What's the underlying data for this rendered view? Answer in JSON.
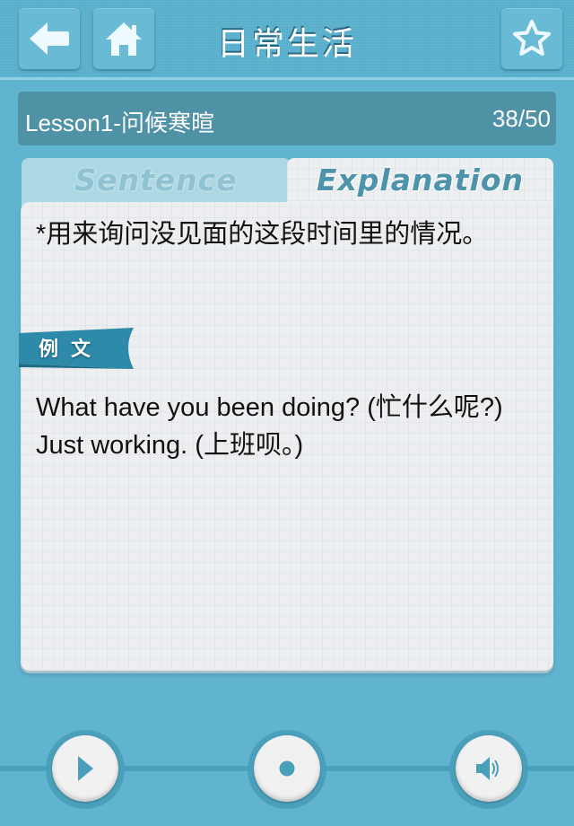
{
  "navbar": {
    "title": "日常生活",
    "back_icon": "arrow-left-icon",
    "home_icon": "home-icon",
    "favorite_icon": "star-outline-icon"
  },
  "lesson": {
    "title": "Lesson1-问候寒暄",
    "progress": "38/50",
    "current": 38,
    "total": 50
  },
  "tabs": [
    {
      "label": "Sentence",
      "active": false
    },
    {
      "label": "Explanation",
      "active": true
    }
  ],
  "card": {
    "explanation": "*用来询问没见面的这段时间里的情况。",
    "example_label": "例文",
    "examples": [
      "What have you been doing? (忙什么呢?)",
      "Just working. (上班呗。)"
    ]
  },
  "controls": {
    "play_icon": "play-icon",
    "record_icon": "record-icon",
    "sound_icon": "speaker-icon"
  },
  "colors": {
    "background": "#61b4cf",
    "lesson_bar": "#4f92a6",
    "accent": "#4a9fba",
    "card": "#eceef0",
    "ribbon": "#2d8aa8"
  }
}
